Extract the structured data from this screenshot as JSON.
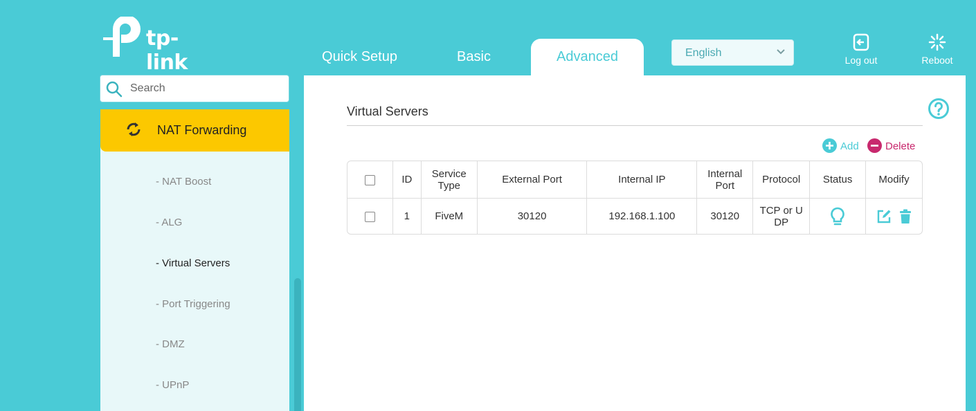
{
  "header": {
    "brand": "tp-link",
    "tabs": [
      {
        "label": "Quick Setup",
        "active": false
      },
      {
        "label": "Basic",
        "active": false
      },
      {
        "label": "Advanced",
        "active": true
      }
    ],
    "language": {
      "selected": "English"
    },
    "logout_label": "Log out",
    "reboot_label": "Reboot"
  },
  "sidebar": {
    "search_placeholder": "Search",
    "section": {
      "label": "NAT Forwarding",
      "icon": "nat-forwarding-icon"
    },
    "items": [
      {
        "label": "- NAT Boost",
        "active": false
      },
      {
        "label": "- ALG",
        "active": false
      },
      {
        "label": "- Virtual Servers",
        "active": true
      },
      {
        "label": "- Port Triggering",
        "active": false
      },
      {
        "label": "- DMZ",
        "active": false
      },
      {
        "label": "- UPnP",
        "active": false
      }
    ]
  },
  "main": {
    "title": "Virtual Servers",
    "add_label": "Add",
    "delete_label": "Delete",
    "table": {
      "headers": [
        "",
        "ID",
        "Service Type",
        "External Port",
        "Internal IP",
        "Internal Port",
        "Protocol",
        "Status",
        "Modify"
      ],
      "rows": [
        {
          "id": "1",
          "service_type": "FiveM",
          "external_port": "30120",
          "internal_ip": "192.168.1.100",
          "internal_port": "30120",
          "protocol": "TCP or UDP",
          "status_icon": "lightbulb-icon"
        }
      ]
    }
  },
  "colors": {
    "background": "#4acbd6",
    "accent": "#4acbd6",
    "active_section": "#fcc800",
    "delete": "#c8296e"
  }
}
